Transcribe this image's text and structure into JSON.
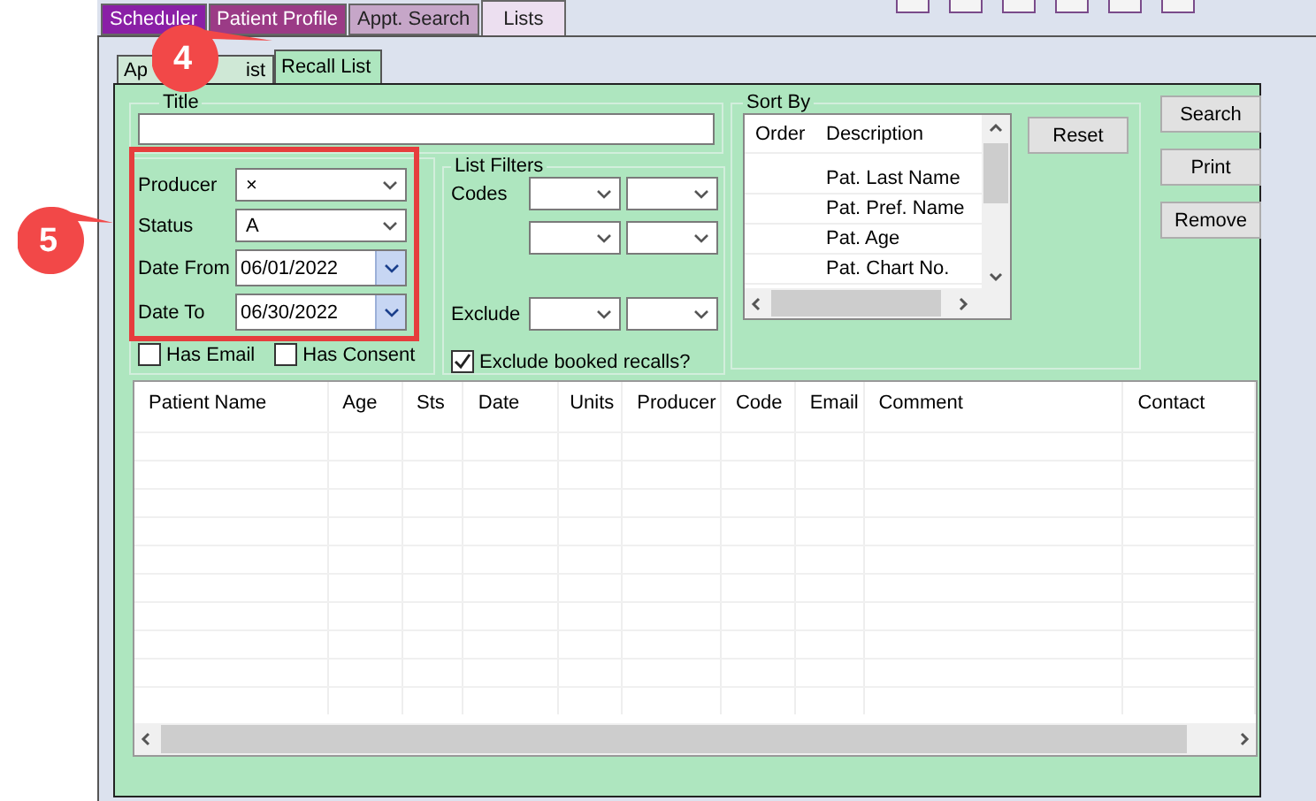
{
  "top_tabs": [
    {
      "label": "Scheduler",
      "color": "#8a1fa6",
      "selected": false
    },
    {
      "label": "Patient Profile",
      "color": "#9b3b86",
      "selected": false
    },
    {
      "label": "Appt. Search",
      "color": "#c6a6c8",
      "selected": false
    },
    {
      "label": "Lists",
      "color": "#ecdff0",
      "selected": true
    }
  ],
  "sub_tabs": [
    {
      "label": "Ap",
      "label_tail": "ist",
      "selected": false
    },
    {
      "label": "Recall List",
      "selected": true
    }
  ],
  "callouts": [
    {
      "number": "4"
    },
    {
      "number": "5"
    }
  ],
  "title_field": {
    "label": "Title"
  },
  "criteria": [
    {
      "label": "Producer",
      "kind": "combo",
      "value": "×"
    },
    {
      "label": "Status",
      "kind": "combo",
      "value": "A"
    },
    {
      "label": "Date From",
      "kind": "date",
      "value": "06/01/2022"
    },
    {
      "label": "Date To",
      "kind": "date",
      "value": "06/30/2022"
    }
  ],
  "checks": [
    {
      "label": "Has Email",
      "checked": false
    },
    {
      "label": "Has Consent",
      "checked": false
    }
  ],
  "list_filters": {
    "title": "List Filters",
    "codes_label": "Codes",
    "exclude_label": "Exclude",
    "exclude_booked": {
      "label": "Exclude booked recalls?",
      "checked": true
    }
  },
  "sort_by": {
    "title": "Sort By",
    "columns": [
      "Order",
      "Description"
    ],
    "rows": [
      "Pat. Last Name",
      "Pat. Pref. Name",
      "Pat. Age",
      "Pat. Chart No."
    ]
  },
  "reset_button": "Reset",
  "side_buttons": [
    "Search",
    "Print",
    "Remove"
  ],
  "grid": {
    "columns": [
      "Patient Name",
      "Age",
      "Sts",
      "Date",
      "Units",
      "Producer",
      "Code",
      "Email",
      "Comment",
      "Contact"
    ]
  }
}
